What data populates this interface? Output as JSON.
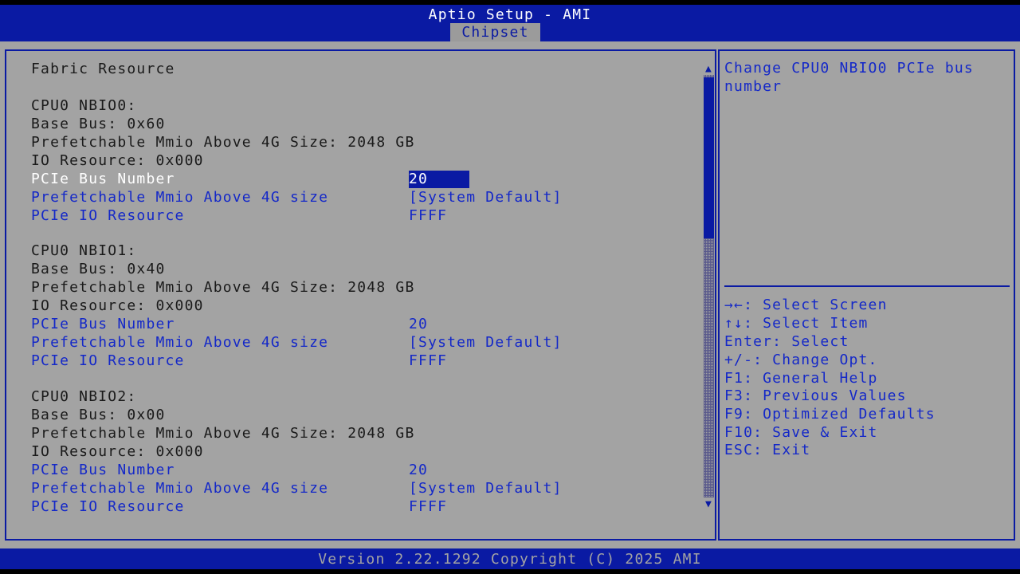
{
  "header": {
    "title": "Aptio Setup - AMI",
    "active_tab": "Chipset"
  },
  "section_title": "Fabric Resource",
  "nbios": [
    {
      "name": "CPU0 NBIO0:",
      "base_bus": "Base Bus: 0x60",
      "mmio_size": "Prefetchable Mmio Above 4G Size: 2048 GB",
      "io_resource": "IO Resource: 0x000",
      "bus_number_label": "PCIe Bus Number",
      "bus_number_value": "20",
      "mmio_label": "Prefetchable Mmio Above 4G size",
      "mmio_value": "[System Default]",
      "io_label": "PCIe IO Resource",
      "io_value": "FFFF"
    },
    {
      "name": "CPU0 NBIO1:",
      "base_bus": "Base Bus: 0x40",
      "mmio_size": "Prefetchable Mmio Above 4G Size: 2048 GB",
      "io_resource": "IO Resource: 0x000",
      "bus_number_label": "PCIe Bus Number",
      "bus_number_value": "20",
      "mmio_label": "Prefetchable Mmio Above 4G size",
      "mmio_value": "[System Default]",
      "io_label": "PCIe IO Resource",
      "io_value": "FFFF"
    },
    {
      "name": "CPU0 NBIO2:",
      "base_bus": "Base Bus: 0x00",
      "mmio_size": "Prefetchable Mmio Above 4G Size: 2048 GB",
      "io_resource": "IO Resource: 0x000",
      "bus_number_label": "PCIe Bus Number",
      "bus_number_value": "20",
      "mmio_label": "Prefetchable Mmio Above 4G size",
      "mmio_value": "[System Default]",
      "io_label": "PCIe IO Resource",
      "io_value": "FFFF"
    }
  ],
  "help_text": [
    "Change CPU0 NBIO0 PCIe bus",
    "number"
  ],
  "keys": [
    "→←: Select Screen",
    "↑↓: Select Item",
    "Enter: Select",
    "+/-: Change Opt.",
    "F1: General Help",
    "F3: Previous Values",
    "F9: Optimized Defaults",
    "F10: Save & Exit",
    "ESC: Exit"
  ],
  "footer": "Version 2.22.1292 Copyright (C) 2025 AMI",
  "colors": {
    "accent": "#0a1aa3",
    "background": "#a3a3a3",
    "link": "#1428c8"
  }
}
